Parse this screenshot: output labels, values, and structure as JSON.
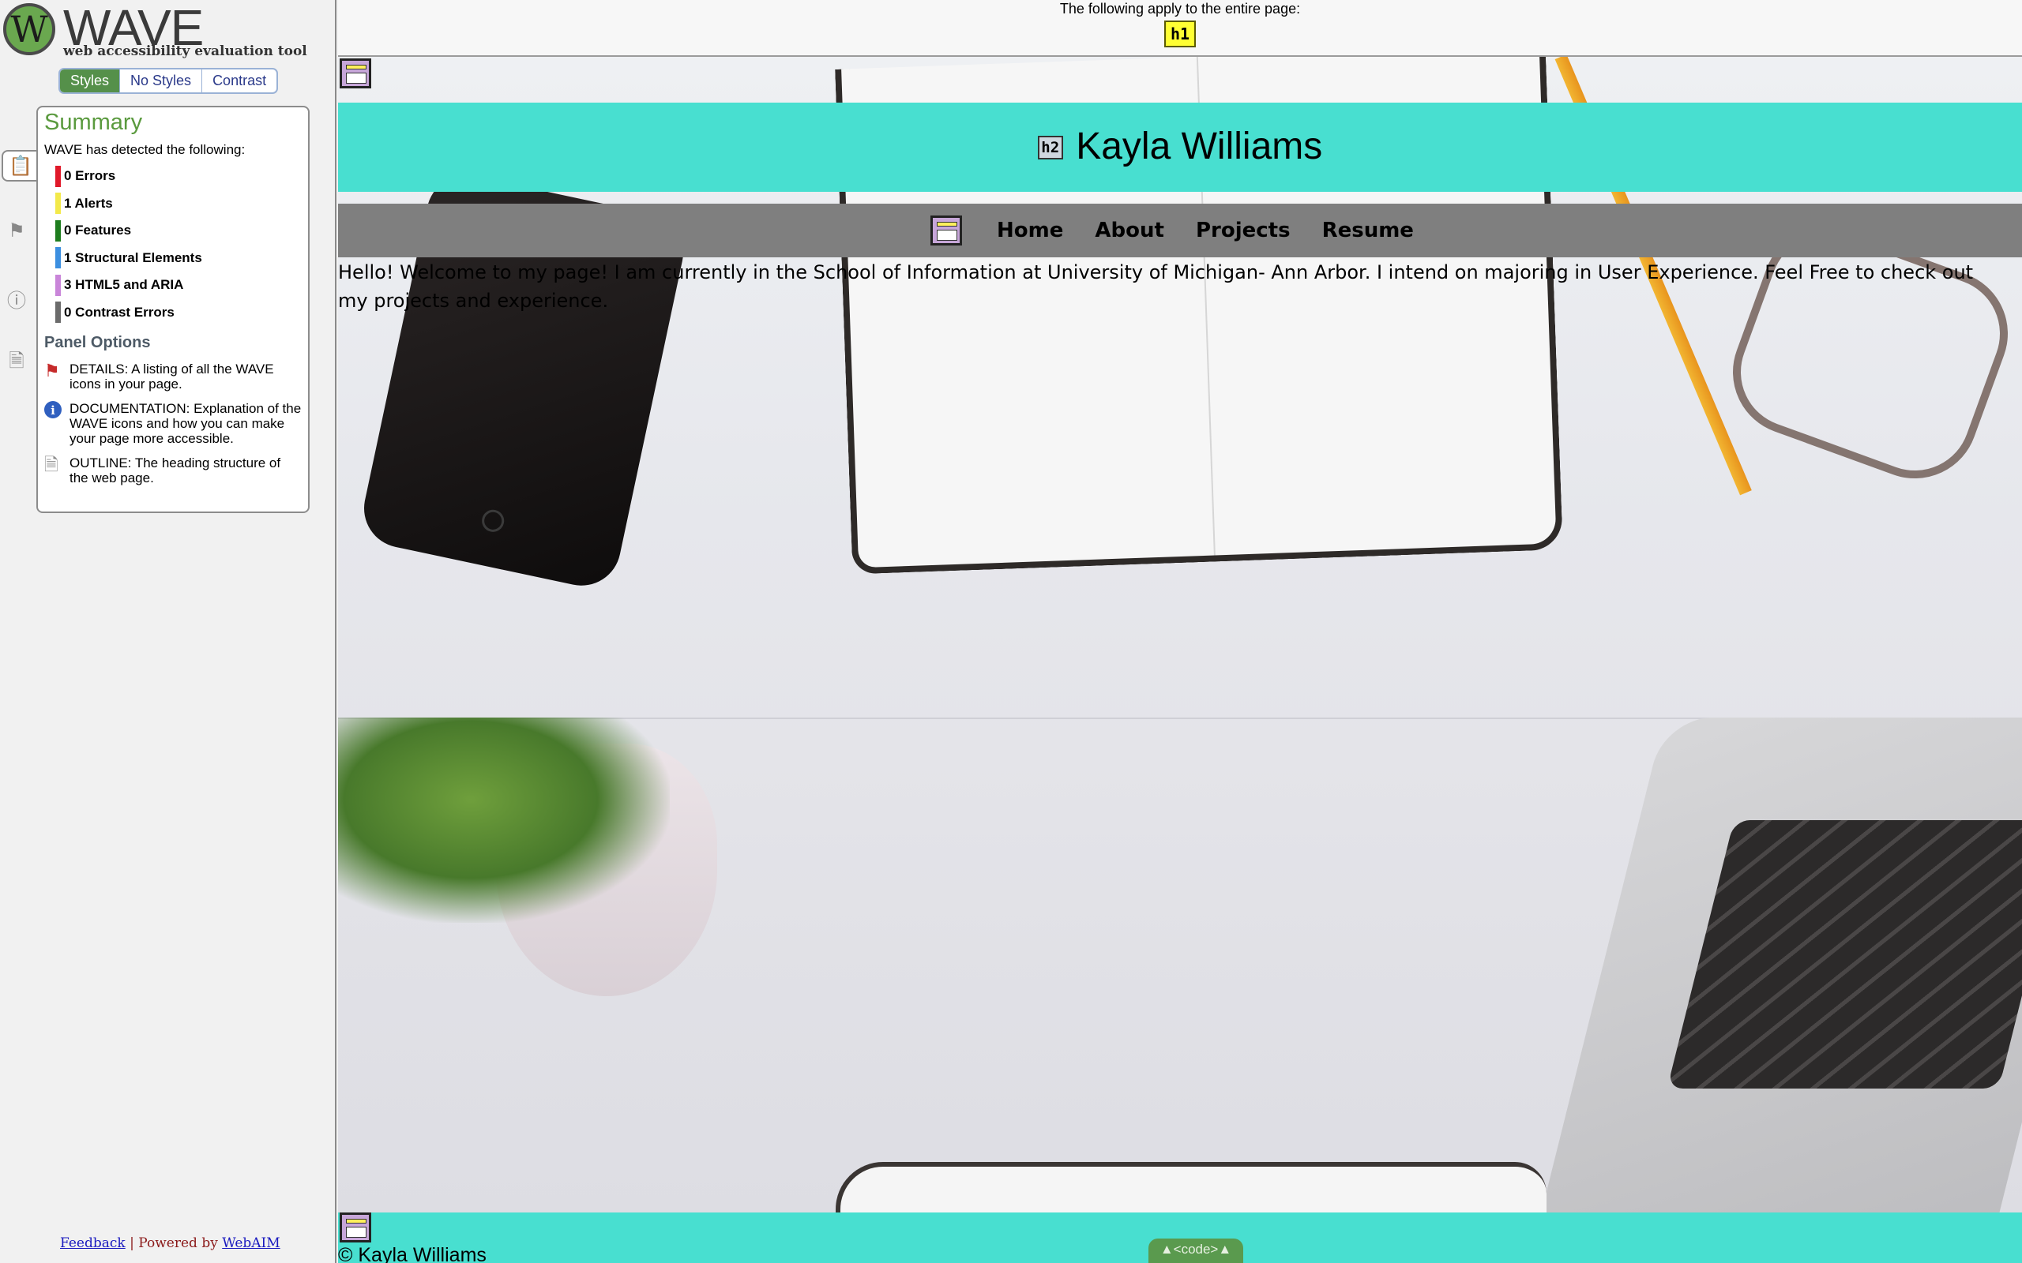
{
  "wave": {
    "logo_letter": "W",
    "title": "WAVE",
    "subtitle": "web accessibility evaluation tool",
    "view_tabs": [
      {
        "label": "Styles",
        "active": true
      },
      {
        "label": "No Styles",
        "active": false
      },
      {
        "label": "Contrast",
        "active": false
      }
    ],
    "side_icons": [
      "clipboard-icon",
      "flag-icon",
      "info-icon",
      "document-icon"
    ],
    "summary": {
      "title": "Summary",
      "intro": "WAVE has detected the following:",
      "items": [
        {
          "label": "0 Errors",
          "color": "#e0192a"
        },
        {
          "label": "1 Alerts",
          "color": "#f3e94a"
        },
        {
          "label": "0 Features",
          "color": "#1e7d1e"
        },
        {
          "label": "1 Structural Elements",
          "color": "#3c8fe0"
        },
        {
          "label": "3 HTML5 and ARIA",
          "color": "#c985d9"
        },
        {
          "label": "0 Contrast Errors",
          "color": "#6b6b6b"
        }
      ],
      "panel_options_title": "Panel Options",
      "options": [
        {
          "icon": "flag-icon",
          "text": "DETAILS: A listing of all the WAVE icons in your page."
        },
        {
          "icon": "info-icon",
          "text": "DOCUMENTATION: Explanation of the WAVE icons and how you can make your page more accessible."
        },
        {
          "icon": "document-icon",
          "text": "OUTLINE: The heading structure of the web page."
        }
      ]
    },
    "footer": {
      "feedback": "Feedback",
      "separator": "|",
      "powered_by": "Powered by",
      "webaim": "WebAIM"
    }
  },
  "page": {
    "notice": "The following apply to the entire page:",
    "h1_badge": "h1",
    "h2_badge": "h2",
    "site_title": "Kayla Williams",
    "nav": [
      "Home",
      "About",
      "Projects",
      "Resume"
    ],
    "intro": "Hello! Welcome to my page! I am currently in the School of Information at University of Michigan- Ann Arbor. I intend on majoring in User Experience. Feel Free to check out my projects and experience.",
    "footer_text": "© Kayla Williams",
    "code_toggle": "▲<code>▲",
    "colors": {
      "band": "#48dfd0",
      "nav": "#7f7f7f",
      "wave_green": "#5a9a3e"
    }
  }
}
